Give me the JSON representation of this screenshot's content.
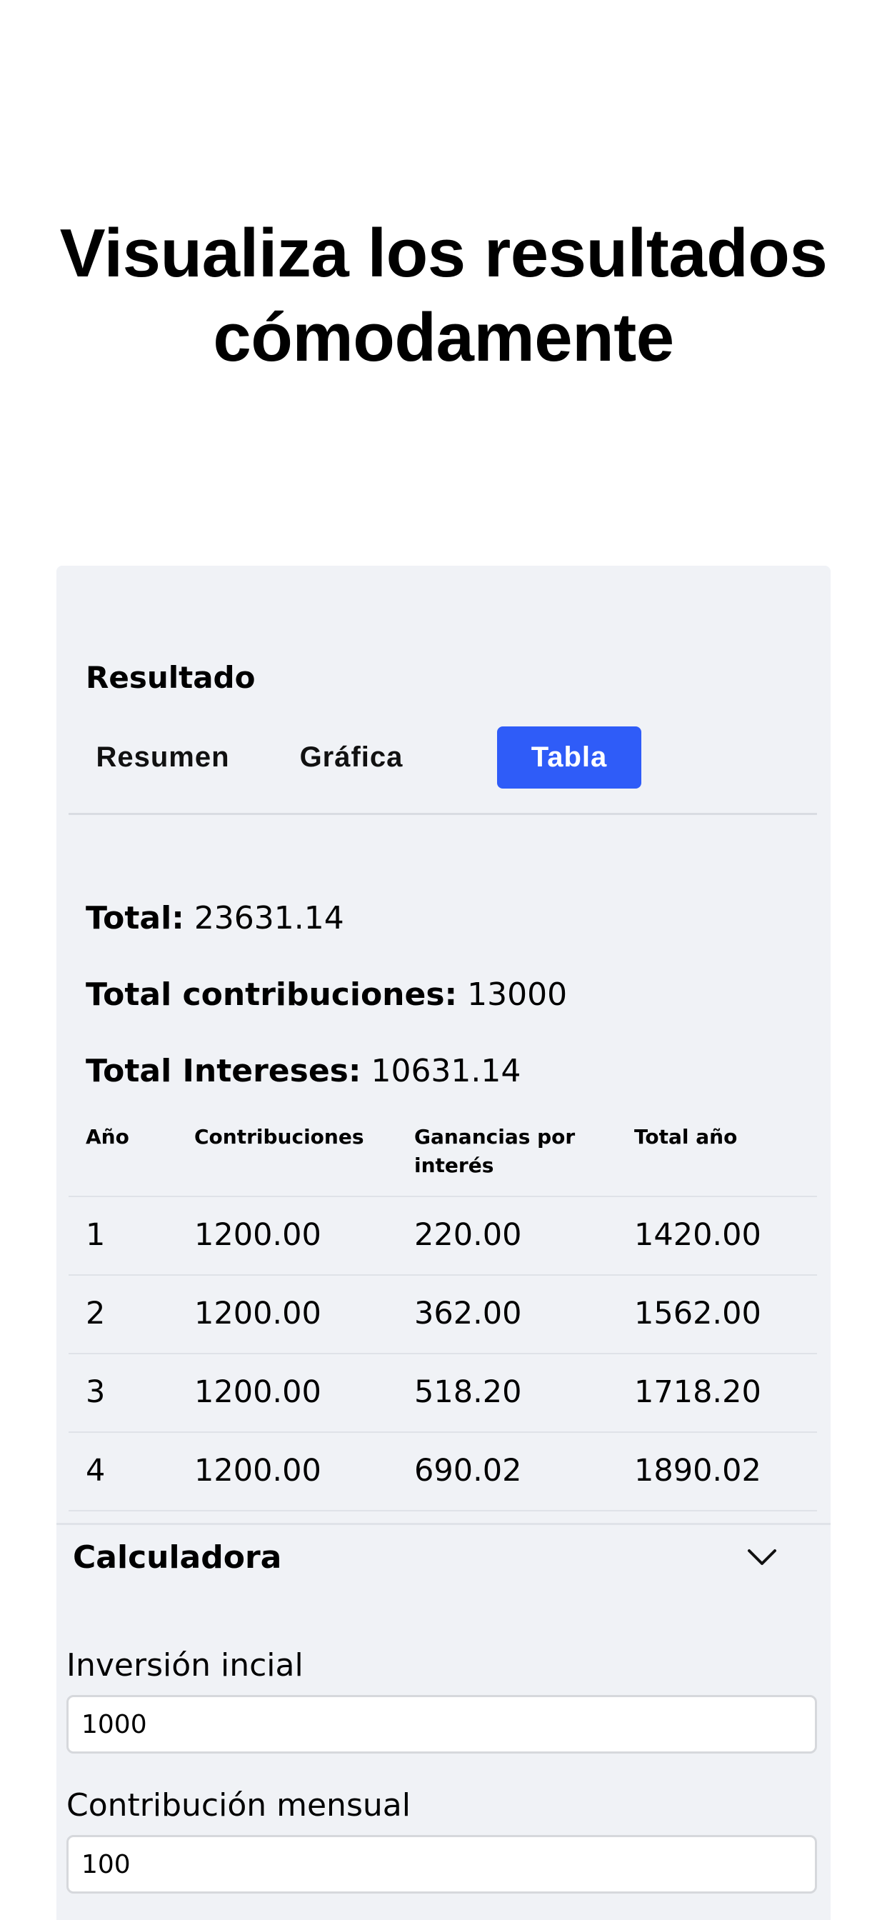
{
  "headline": {
    "line1": "Visualiza los resultados",
    "line2": "cómodamente"
  },
  "results": {
    "title": "Resultado",
    "tabs": [
      {
        "label": "Resumen",
        "active": false
      },
      {
        "label": "Gráfica",
        "active": false
      },
      {
        "label": "Tabla",
        "active": true
      }
    ],
    "accent_color": "#2f5cf8",
    "summary": {
      "total_label": "Total:",
      "total_value": "23631.14",
      "contrib_label": "Total contribuciones:",
      "contrib_value": "13000",
      "interest_label": "Total Intereses:",
      "interest_value": "10631.14"
    },
    "table": {
      "headers": [
        "Año",
        "Contribuciones",
        "Ganancias por interés",
        "Total año"
      ],
      "rows": [
        [
          "1",
          "1200.00",
          "220.00",
          "1420.00"
        ],
        [
          "2",
          "1200.00",
          "362.00",
          "1562.00"
        ],
        [
          "3",
          "1200.00",
          "518.20",
          "1718.20"
        ],
        [
          "4",
          "1200.00",
          "690.02",
          "1890.02"
        ]
      ]
    }
  },
  "calculator": {
    "title": "Calculadora",
    "toggle_icon": "chevron-down-icon",
    "initial_label": "Inversión incial",
    "initial_value": "1000",
    "monthly_label": "Contribución mensual",
    "monthly_value": "100"
  }
}
